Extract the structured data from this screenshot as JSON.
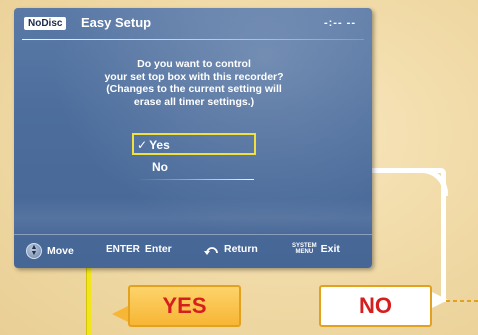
{
  "header": {
    "badge": "NoDisc",
    "title": "Easy Setup",
    "clock": "-:-- --"
  },
  "question": {
    "line1": "Do you want to control",
    "line2": "your set top box with this recorder?",
    "line3": "(Changes to the current setting will",
    "line4": "erase all timer settings.)"
  },
  "options": {
    "yes": {
      "check": "✓",
      "label": "Yes",
      "selected": true
    },
    "no": {
      "label": "No"
    }
  },
  "footer": {
    "move_label": "Move",
    "enter_key": "ENTER",
    "enter_label": "Enter",
    "return_label": "Return",
    "system_key_line1": "SYSTEM",
    "system_key_line2": "MENU",
    "exit_label": "Exit"
  },
  "callouts": {
    "yes": "YES",
    "no": "NO"
  },
  "colors": {
    "panel": "#4d6e9d",
    "highlight": "#f0e040",
    "yes_callout": "#f7b635",
    "callout_text": "#d51e1e"
  }
}
